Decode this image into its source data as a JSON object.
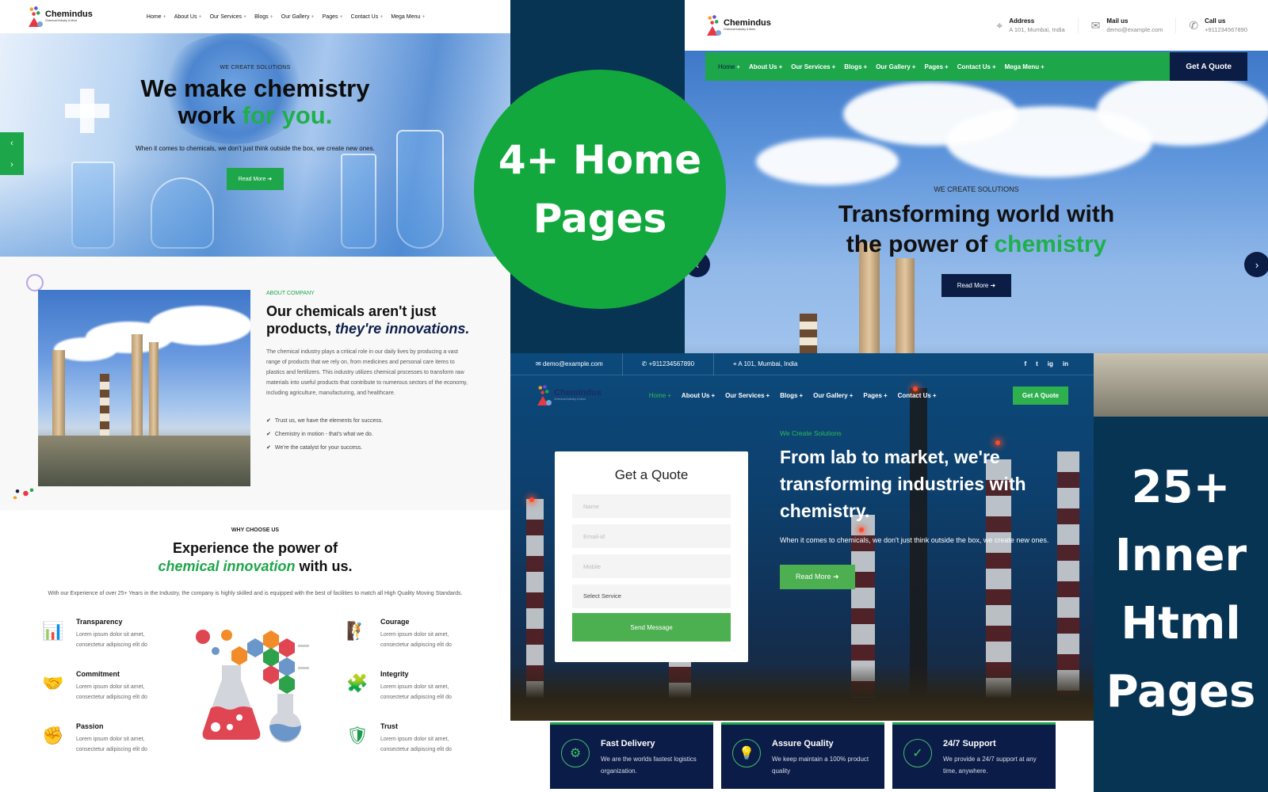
{
  "promo": {
    "home_pages": [
      "4+ Home",
      "Pages"
    ],
    "inner_pages": [
      "25+",
      "Inner",
      "Html",
      "Pages"
    ]
  },
  "brand": {
    "name": "Chemindus",
    "tagline": "Chemical Industry & More"
  },
  "colors": {
    "green": "#1ea64a",
    "navy": "#0b1c45",
    "background": "#083454"
  },
  "home1": {
    "nav": [
      {
        "label": "Home",
        "active": false
      },
      {
        "label": "About Us"
      },
      {
        "label": "Our Services"
      },
      {
        "label": "Blogs"
      },
      {
        "label": "Our Gallery"
      },
      {
        "label": "Pages"
      },
      {
        "label": "Contact Us"
      },
      {
        "label": "Mega Menu"
      }
    ],
    "hero": {
      "eyebrow": "WE CREATE SOLUTIONS",
      "title_line1": "We make chemistry",
      "title_line2_a": "work ",
      "title_line2_b": "for you.",
      "subtitle": "When it comes to chemicals, we don't just think outside the box, we create new ones.",
      "button": "Read More ➜",
      "prev_arrow": "‹",
      "next_arrow": "›"
    },
    "about": {
      "eyebrow": "ABOUT COMPANY",
      "title_a": "Our chemicals aren't just products, ",
      "title_b": "they're innovations.",
      "body": "The chemical industry plays a critical role in our daily lives by producing a vast range of products that we rely on, from medicines and personal care items to plastics and fertilizers. This industry utilizes chemical processes to transform raw materials into useful products that contribute to numerous sectors of the economy, including agriculture, manufacturing, and healthcare.",
      "checklist": [
        "Trust us, we have the elements for success.",
        "Chemistry in motion - that's what we do.",
        "We're the catalyst for your success."
      ]
    },
    "why": {
      "eyebrow": "WHY CHOOSE US",
      "title_a": "Experience the power of",
      "title_b": "chemical innovation",
      "title_c": " with us.",
      "subtitle": "With our Experience of over 25+ Years in the Industry, the company is highly skilled and is equipped with the best of facilities to match all High Quality Moving Standards.",
      "features": [
        {
          "title": "Transparency",
          "desc": "Lorem ipsum dolor sit amet, consectetur adipiscing elit do",
          "icon": "📊"
        },
        {
          "title": "Commitment",
          "desc": "Lorem ipsum dolor sit amet, consectetur adipiscing elit do",
          "icon": "🤝"
        },
        {
          "title": "Passion",
          "desc": "Lorem ipsum dolor sit amet, consectetur adipiscing elit do",
          "icon": "✊"
        },
        {
          "title": "Courage",
          "desc": "Lorem ipsum dolor sit amet, consectetur adipiscing elit do",
          "icon": "🧗"
        },
        {
          "title": "Integrity",
          "desc": "Lorem ipsum dolor sit amet, consectetur adipiscing elit do",
          "icon": "🧩"
        },
        {
          "title": "Trust",
          "desc": "Lorem ipsum dolor sit amet, consectetur adipiscing elit do",
          "icon": "🛡"
        }
      ]
    }
  },
  "home2": {
    "contacts": [
      {
        "label": "Address",
        "value": "A 101, Mumbai, India",
        "icon": "⌖"
      },
      {
        "label": "Mail us",
        "value": "demo@example.com",
        "icon": "✉"
      },
      {
        "label": "Call us",
        "value": "+911234567890",
        "icon": "✆"
      }
    ],
    "nav": [
      "Home",
      "About Us",
      "Our Services",
      "Blogs",
      "Our Gallery",
      "Pages",
      "Contact Us",
      "Mega Menu"
    ],
    "quote_button": "Get A Quote",
    "hero": {
      "eyebrow": "WE CREATE SOLUTIONS",
      "title_line1": "Transforming world with",
      "title_line2_a": "the power of ",
      "title_line2_b": "chemistry",
      "button": "Read More ➜",
      "prev_arrow": "‹",
      "next_arrow": "›"
    }
  },
  "home3": {
    "topbar": {
      "email": "✉  demo@example.com",
      "phone": "✆  +911234567890",
      "address": "⌖  A 101, Mumbai, India",
      "social": [
        "f",
        "t",
        "ig",
        "in"
      ]
    },
    "nav": [
      "Home",
      "About Us",
      "Our Services",
      "Blogs",
      "Our Gallery",
      "Pages",
      "Contact Us"
    ],
    "quote_button": "Get A Quote",
    "form": {
      "title": "Get a Quote",
      "name_placeholder": "Name",
      "email_placeholder": "Email-id",
      "mobile_placeholder": "Mobile",
      "service_selected": "Select Service",
      "submit": "Send Message"
    },
    "hero": {
      "eyebrow": "We Create Solutions",
      "title": "From lab to market, we're transforming industries with chemistry.",
      "subtitle": "When it comes to chemicals, we don't just think outside the box, we create new ones.",
      "button": "Read More ➜"
    },
    "features": [
      {
        "title": "Fast Delivery",
        "desc": "We are the worlds fastest logistics organization.",
        "icon": "⚙"
      },
      {
        "title": "Assure Quality",
        "desc": "We keep maintain a 100% product quality",
        "icon": "💡"
      },
      {
        "title": "24/7 Support",
        "desc": "We provide a 24/7 support at any time, anywhere.",
        "icon": "✓"
      }
    ]
  }
}
